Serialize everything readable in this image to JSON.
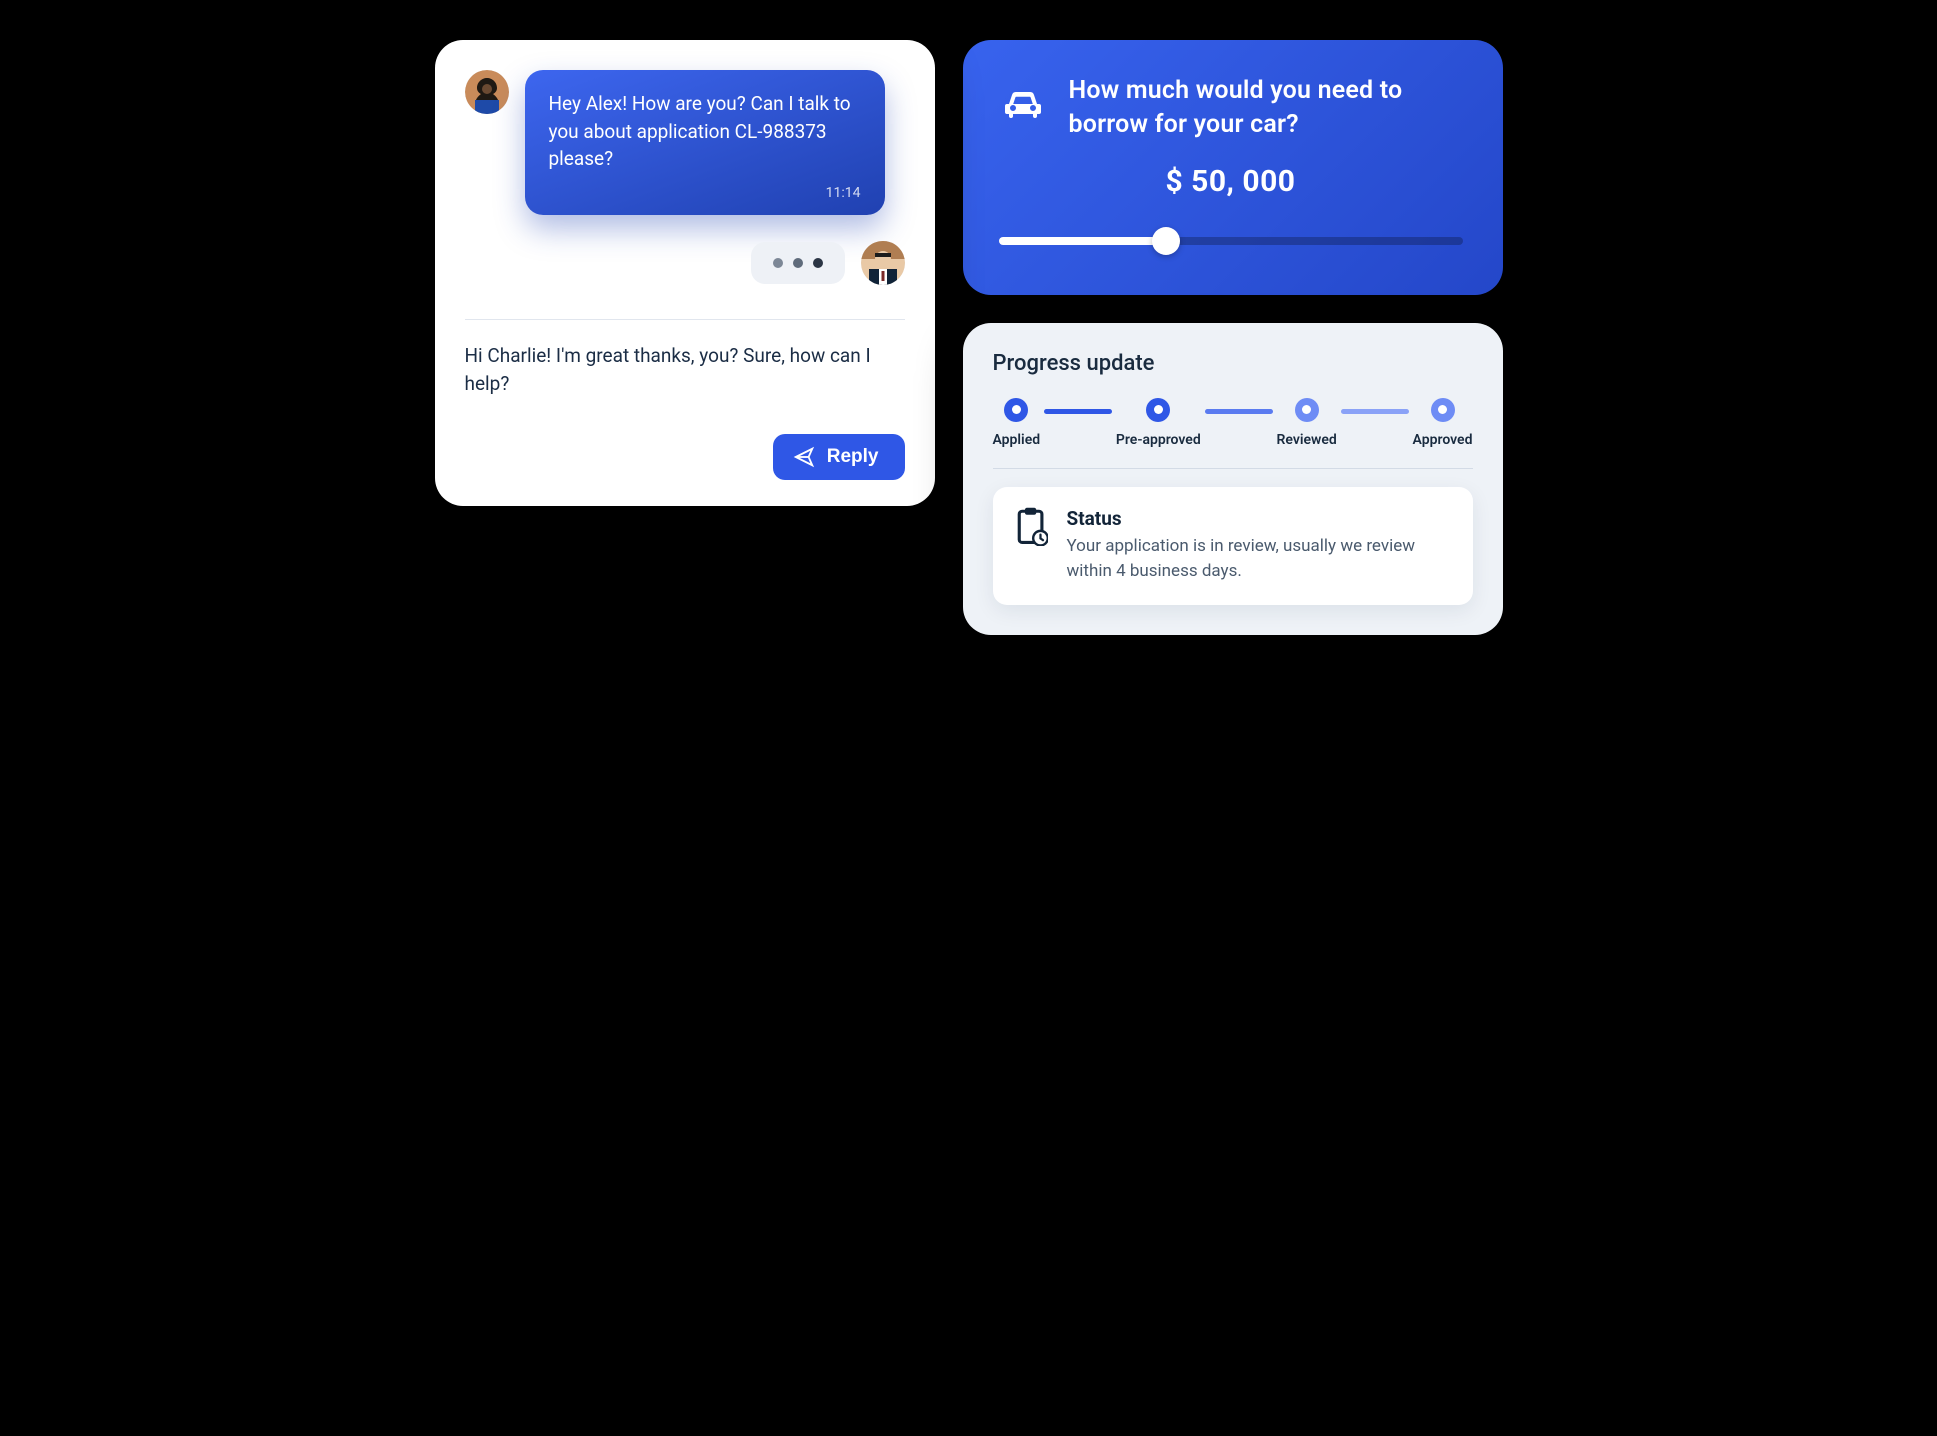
{
  "loan": {
    "question": "How much would you need to borrow for your car?",
    "amount": "$ 50, 000",
    "slider_percent": 36
  },
  "progress": {
    "title": "Progress update",
    "steps": [
      "Applied",
      "Pre-approved",
      "Reviewed",
      "Approved"
    ],
    "status": {
      "heading": "Status",
      "body": "Your application is in review, usually we review within 4 business days."
    }
  },
  "chat": {
    "messages": [
      {
        "from": "other",
        "text": "Hey Alex! How are you? Can I talk to you about application CL-988373 please?",
        "time": "11:14"
      }
    ],
    "compose_text": "Hi Charlie! I'm great thanks, you? Sure, how can I help?",
    "reply_label": "Reply"
  }
}
